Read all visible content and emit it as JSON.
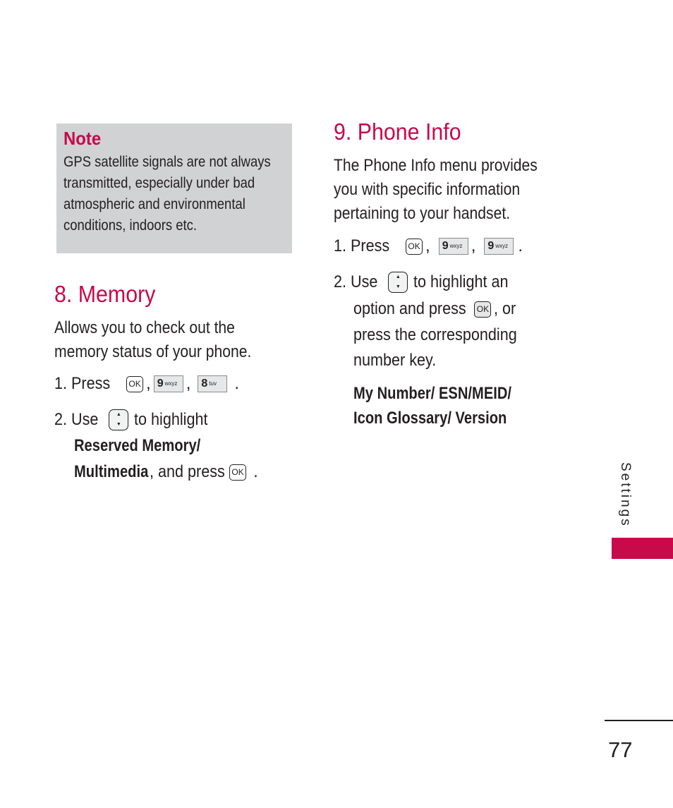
{
  "note": {
    "title": "Note",
    "lines": [
      "GPS satellite signals are not always",
      "transmitted, especially under bad",
      "atmospheric and environmental",
      "conditions, indoors etc."
    ]
  },
  "memory": {
    "heading": "8. Memory",
    "intro": [
      "Allows you to check out the",
      "memory status of your phone."
    ],
    "step1": {
      "prefix": "1. Press",
      "keys": [
        {
          "label": "OK"
        },
        {
          "digit": "9",
          "letters": "wxyz"
        },
        {
          "digit": "8",
          "letters": "tuv"
        }
      ],
      "sep": ",",
      "end": "."
    },
    "step2": {
      "prefix": "2. Use",
      "middle": "to highlight",
      "bold_line1": "Reserved Memory/",
      "bold_line2": "Multimedia",
      "tail": ", and press",
      "ok": "OK",
      "end": "."
    }
  },
  "phone_info": {
    "heading": "9. Phone Info",
    "intro": [
      "The Phone Info menu provides",
      "you with specific information",
      "pertaining to your handset."
    ],
    "step1": {
      "prefix": "1. Press",
      "keys": [
        {
          "label": "OK"
        },
        {
          "digit": "9",
          "letters": "wxyz"
        },
        {
          "digit": "9",
          "letters": "wxyz"
        }
      ],
      "sep": ",",
      "end": "."
    },
    "step2": {
      "prefix": "2. Use",
      "line1_tail": "to highlight an",
      "line2_pre": "option and press",
      "ok": "OK",
      "line2_tail": ", or",
      "line3": "press the corresponding",
      "line4": "number key."
    },
    "options": [
      "My Number/ ESN/MEID/",
      "Icon Glossary/ Version"
    ]
  },
  "side_tab": {
    "label": "Settings",
    "color": "#c8094a"
  },
  "page_number": "77",
  "colors": {
    "accent": "#c8094a",
    "note_bg": "#d1d2d4",
    "text": "#231f20"
  }
}
